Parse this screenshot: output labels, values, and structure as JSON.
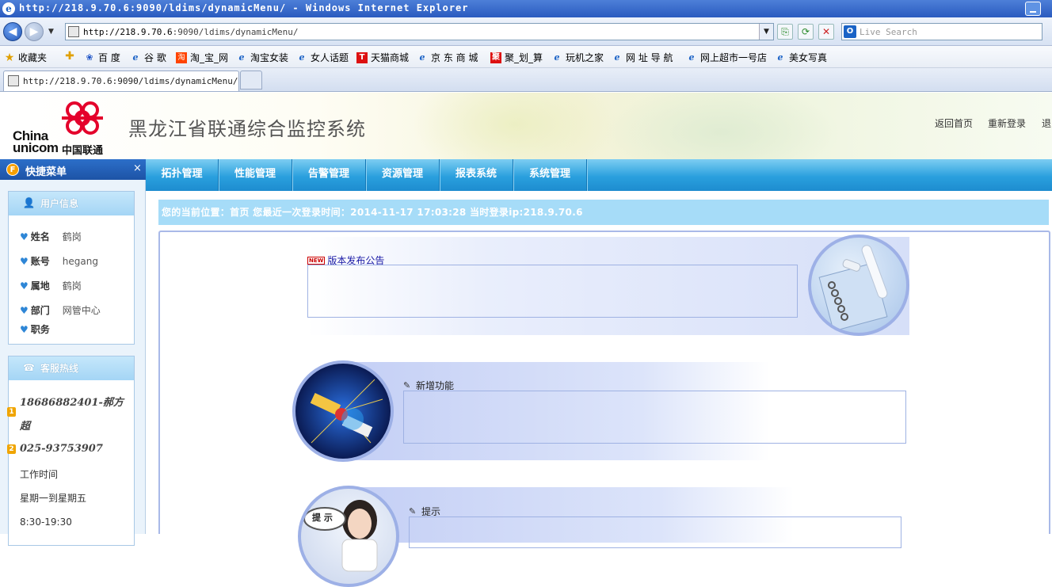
{
  "browser": {
    "window_title": "http://218.9.70.6:9090/ldims/dynamicMenu/ - Windows Internet Explorer",
    "url_host": "http://218.9.70.6",
    "url_path": ":9090/ldims/dynamicMenu/",
    "search_placeholder": "Live Search",
    "tab_title": "http://218.9.70.6:9090/ldims/dynamicMenu/",
    "favorites_label": "收藏夹",
    "favorites": [
      "百 度",
      "谷 歌",
      "淘_宝_网",
      "淘宝女装",
      "女人话题",
      "天猫商城",
      "京 东 商 城",
      "聚_划_算",
      "玩机之家",
      "网 址 导 航",
      "网上超市一号店",
      "美女写真"
    ]
  },
  "header": {
    "brand_en_1": "China",
    "brand_en_2": "unicom",
    "brand_cn": "中国联通",
    "system_title": "黑龙江省联通综合监控系统",
    "links": [
      "返回首页",
      "重新登录",
      "退"
    ]
  },
  "menu": {
    "items": [
      "拓扑管理",
      "性能管理",
      "告警管理",
      "资源管理",
      "报表系统",
      "系统管理"
    ]
  },
  "sidebar": {
    "title": "快捷菜单",
    "close": "×",
    "user_panel": {
      "title": "用户信息",
      "rows": [
        {
          "key": "姓名",
          "value": "鹤岗"
        },
        {
          "key": "账号",
          "value": "hegang"
        },
        {
          "key": "属地",
          "value": "鹤岗"
        },
        {
          "key": "部门",
          "value": "网管中心"
        },
        {
          "key": "职务",
          "value": ""
        }
      ]
    },
    "hotline_panel": {
      "title": "客服热线",
      "phone1": "18686882401-郝方",
      "phone1_cont": "超",
      "phone2": "025-93753907",
      "hours_label": "工作时间",
      "days": "星期一到星期五",
      "time": "8:30-19:30"
    }
  },
  "breadcrumb": "您的当前位置：首页 您最近一次登录时间：2014-11-17 17:03:28 当时登录ip:218.9.70.6",
  "content": {
    "notice_title": "版本发布公告",
    "new_features_title": "新增功能",
    "tips_title": "提示",
    "tips_bubble": "提 示"
  },
  "colors": {
    "menu_blue": "#2aa0de",
    "crumb_blue": "#a6dcf8",
    "panel_border": "#a9b9e8"
  }
}
